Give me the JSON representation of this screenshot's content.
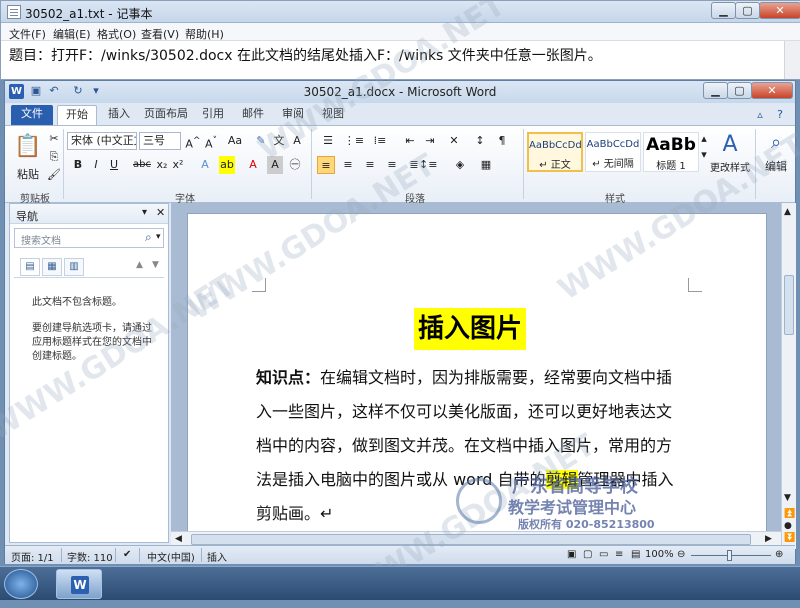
{
  "notepad": {
    "title": "30502_a1.txt - 记事本",
    "menu": [
      "文件(F)",
      "编辑(E)",
      "格式(O)",
      "查看(V)",
      "帮助(H)"
    ],
    "content": "题目：打开F：/winks/30502.docx 在此文档的结尾处插入F：/winks 文件夹中任意一张图片。"
  },
  "word": {
    "title": "30502_a1.docx - Microsoft Word",
    "tabs": [
      "文件",
      "开始",
      "插入",
      "页面布局",
      "引用",
      "邮件",
      "审阅",
      "视图"
    ],
    "active_tab": "开始",
    "ribbon": {
      "clipboard": {
        "paste": "粘贴",
        "label": "剪贴板"
      },
      "font": {
        "name": "宋体 (中文正文)",
        "size": "三号",
        "label": "字体"
      },
      "paragraph": {
        "label": "段落"
      },
      "styles": {
        "label": "样式",
        "cards": [
          {
            "preview": "AaBbCcDd",
            "name": "↵ 正文",
            "selected": true
          },
          {
            "preview": "AaBbCcDd",
            "name": "↵ 无间隔",
            "selected": false
          },
          {
            "preview": "AaBb",
            "name": "标题 1",
            "selected": false
          }
        ],
        "change": "更改样式"
      },
      "editing": {
        "label": "编辑"
      }
    },
    "nav": {
      "title": "导航",
      "search_placeholder": "搜索文档",
      "msg1": "此文档不包含标题。",
      "msg2": "要创建导航选项卡，请通过应用标题样式在您的文档中创建标题。"
    },
    "document": {
      "title": "插入图片",
      "lines": [
        {
          "bold": "知识点：",
          "text": "在编辑文档时，因为排版需要，经常要向文档中插"
        },
        {
          "text": "入一些图片，这样不仅可以美化版面，还可以更好地表达文"
        },
        {
          "text": "档中的内容，做到图文并茂。在文档中插入图片，常用的方"
        },
        {
          "text_a": "法是插入电脑中的图片或从 word 自带的",
          "hl": "剪辑",
          "text_b": "管理器中插入"
        },
        {
          "text": "剪贴画。↵"
        }
      ]
    },
    "status": {
      "page": "页面: 1/1",
      "words": "字数: 110",
      "lang": "中文(中国)",
      "mode": "插入",
      "zoom": "100%"
    }
  },
  "watermark": {
    "org_line1": "广东省高等学校",
    "org_line2": "教学考试管理中心",
    "org_line3": "版权所有 020-85213800"
  }
}
